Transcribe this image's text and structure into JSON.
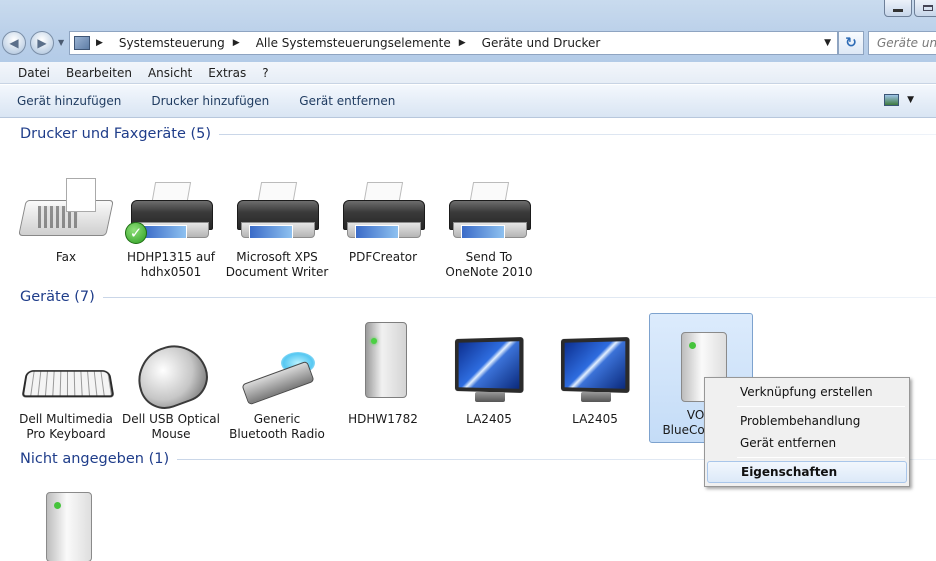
{
  "address_bar": {
    "breadcrumbs": [
      "Systemsteuerung",
      "Alle Systemsteuerungselemente",
      "Geräte und Drucker"
    ],
    "search_placeholder": "Geräte und"
  },
  "menubar": {
    "items": [
      "Datei",
      "Bearbeiten",
      "Ansicht",
      "Extras",
      "?"
    ]
  },
  "commandbar": {
    "items": [
      "Gerät hinzufügen",
      "Drucker hinzufügen",
      "Gerät entfernen"
    ]
  },
  "groups": [
    {
      "title": "Drucker und Faxgeräte (5)",
      "items": [
        {
          "label1": "Fax",
          "label2": "",
          "icon": "fax-icon"
        },
        {
          "label1": "HDHP1315 auf",
          "label2": "hdhx0501",
          "icon": "printer-icon",
          "default": true
        },
        {
          "label1": "Microsoft XPS",
          "label2": "Document Writer",
          "icon": "printer-icon"
        },
        {
          "label1": "PDFCreator",
          "label2": "",
          "icon": "printer-icon"
        },
        {
          "label1": "Send To",
          "label2": "OneNote 2010",
          "icon": "printer-icon"
        }
      ]
    },
    {
      "title": "Geräte (7)",
      "items": [
        {
          "label1": "Dell Multimedia",
          "label2": "Pro Keyboard",
          "icon": "keyboard-icon"
        },
        {
          "label1": "Dell USB Optical",
          "label2": "Mouse",
          "icon": "mouse-icon"
        },
        {
          "label1": "Generic",
          "label2": "Bluetooth Radio",
          "icon": "bluetooth-adapter-icon"
        },
        {
          "label1": "HDHW1782",
          "label2": "",
          "icon": "computer-tower-icon"
        },
        {
          "label1": "LA2405",
          "label2": "",
          "icon": "monitor-icon"
        },
        {
          "label1": "LA2405",
          "label2": "",
          "icon": "monitor-icon"
        },
        {
          "label1": "VOIP",
          "label2": "BlueComm...",
          "icon": "generic-device-icon",
          "selected": true
        }
      ]
    },
    {
      "title": "Nicht angegeben (1)",
      "items": [
        {
          "label1": "",
          "label2": "",
          "icon": "generic-device-icon"
        }
      ]
    }
  ],
  "context_menu": {
    "items": [
      "Verknüpfung erstellen",
      "Problembehandlung",
      "Gerät entfernen",
      "Eigenschaften"
    ],
    "highlighted": "Eigenschaften"
  }
}
